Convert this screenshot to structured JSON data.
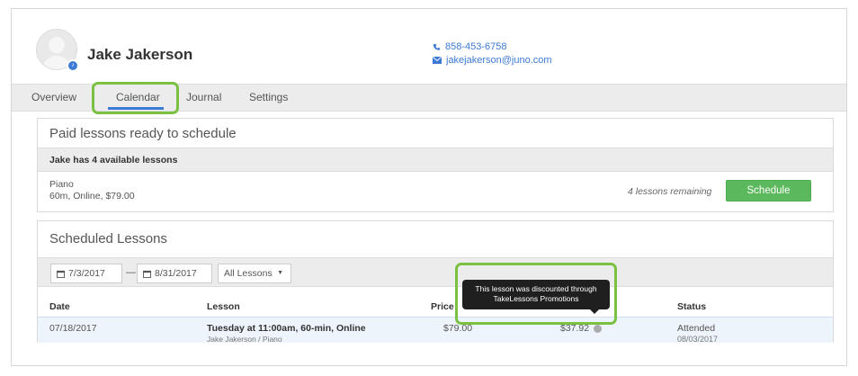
{
  "profile": {
    "name": "Jake Jakerson",
    "phone": "858-453-6758",
    "email": "jakejakerson@juno.com"
  },
  "tabs": [
    {
      "label": "Overview"
    },
    {
      "label": "Calendar",
      "active": true
    },
    {
      "label": "Journal"
    },
    {
      "label": "Settings"
    }
  ],
  "paid_panel": {
    "title": "Paid lessons ready to schedule",
    "available_text": "Jake has 4 available lessons",
    "lesson_name": "Piano",
    "lesson_meta": "60m, Online, $79.00",
    "remaining": "4 lessons remaining",
    "schedule_label": "Schedule"
  },
  "scheduled_panel": {
    "title": "Scheduled Lessons",
    "date_from": "7/3/2017",
    "date_to": "8/31/2017",
    "filter": "All Lessons",
    "filter_caret": "▼",
    "dash": "—",
    "columns": {
      "date": "Date",
      "lesson": "Lesson",
      "price": "Price",
      "status": "Status"
    },
    "rows": [
      {
        "date": "07/18/2017",
        "title": "Tuesday at 11:00am, 60-min, Online",
        "subtitle": "Jake Jakerson / Piano",
        "price": "$79.00",
        "discount_price": "$37.92",
        "status": "Attended",
        "status_date": "08/03/2017"
      }
    ]
  },
  "tooltip": {
    "line1": "This lesson was discounted through",
    "line2": "TakeLessons Promotions"
  },
  "colors": {
    "accent": "#3d7ad6",
    "highlight": "#7ac142",
    "button": "#5cb85c"
  },
  "icons": {
    "phone": "phone-icon",
    "email": "envelope-icon",
    "calendar": "calendar-icon",
    "info": "info-icon"
  }
}
